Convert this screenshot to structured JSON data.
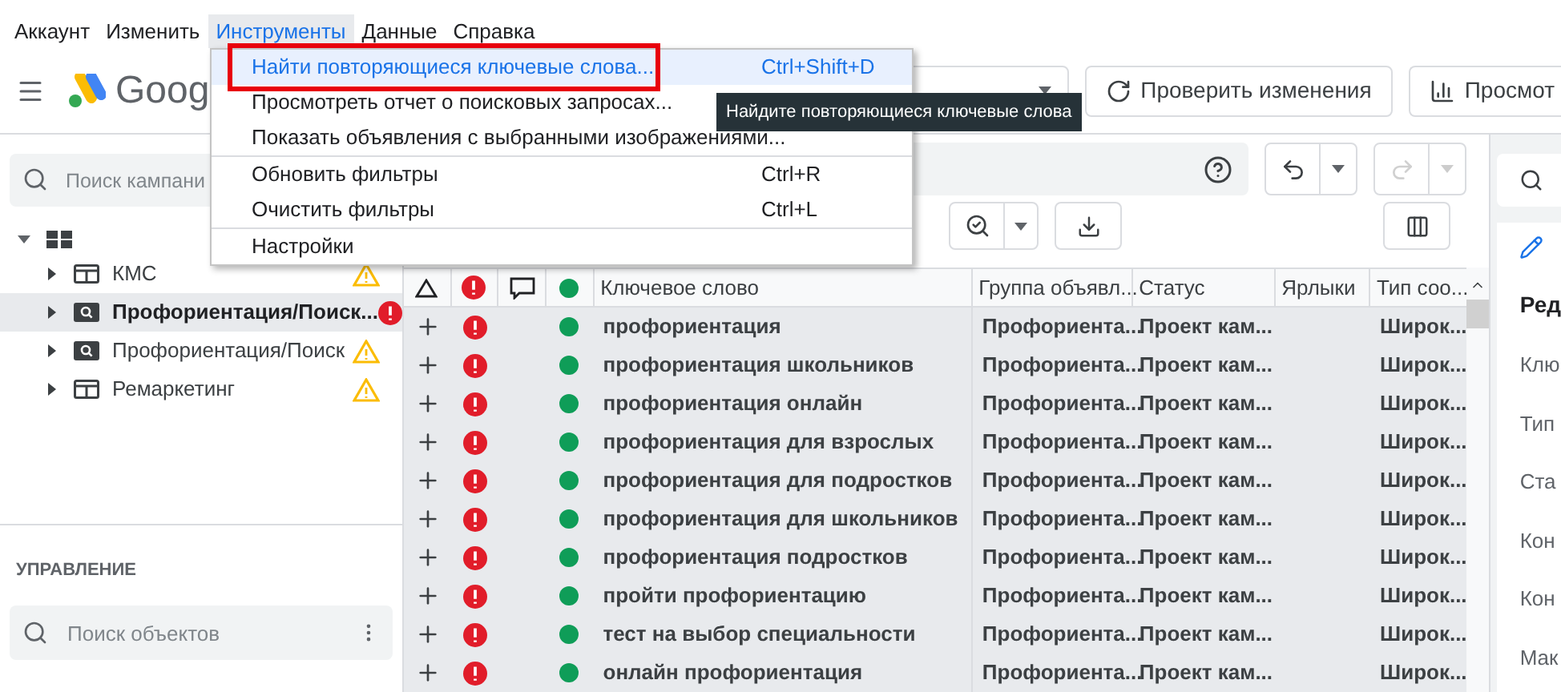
{
  "menu_bar": [
    {
      "label": "Аккаунт",
      "selected": false
    },
    {
      "label": "Изменить",
      "selected": false
    },
    {
      "label": "Инструменты",
      "selected": true
    },
    {
      "label": "Данные",
      "selected": false
    },
    {
      "label": "Справка",
      "selected": false
    }
  ],
  "header": {
    "logo_text": "Goog",
    "buttons": [
      {
        "label": "Проверить изменения",
        "kind": "check"
      },
      {
        "label": "Просмот",
        "kind": "stats"
      }
    ]
  },
  "dropdown": {
    "groups": [
      [
        {
          "label": "Найти повторяющиеся ключевые слова...",
          "shortcut": "Ctrl+Shift+D",
          "selected": true
        },
        {
          "label": "Просмотреть отчет о поисковых запросах...",
          "selected": false
        },
        {
          "label": "Показать объявления с выбранными изображениями...",
          "selected": false
        }
      ],
      [
        {
          "label": "Обновить фильтры",
          "shortcut": "Ctrl+R",
          "selected": false
        },
        {
          "label": "Очистить фильтры",
          "shortcut": "Ctrl+L",
          "selected": false
        }
      ],
      [
        {
          "label": "Настройки",
          "selected": false
        }
      ]
    ]
  },
  "tooltip": "Найдите повторяющиеся ключевые слова",
  "sidebar": {
    "search": {
      "placeholder": "Поиск кампани"
    },
    "tree": {
      "expanded": true,
      "children": [
        {
          "name": "КМС",
          "kind": "display",
          "error": false,
          "selected": false,
          "expanded": false
        },
        {
          "name": "Профориентация/Поиск...",
          "kind": "search",
          "error": true,
          "selected": true,
          "expanded": false
        },
        {
          "name": "Профориентация/Поиск",
          "kind": "search",
          "error": false,
          "selected": false,
          "expanded": false
        },
        {
          "name": "Ремаркетинг",
          "kind": "display",
          "error": false,
          "selected": false,
          "expanded": false
        }
      ]
    },
    "section_title": "УПРАВЛЕНИЕ",
    "object_search": {
      "placeholder": "Поиск объектов"
    }
  },
  "toolbar": {
    "undo_disabled": false,
    "redo_disabled": true
  },
  "table": {
    "columns": [
      "Ключевое слово",
      "Группа объявл...",
      "Статус",
      "Ярлыки",
      "Тип соо..."
    ],
    "rows": [
      {
        "keyword": "профориентация",
        "group": "Профориента...",
        "status": "Проект кам...",
        "type": "Широк...",
        "selected": true
      },
      {
        "keyword": "профориентация школьников",
        "group": "Профориента...",
        "status": "Проект кам...",
        "type": "Широк...",
        "selected": true
      },
      {
        "keyword": "профориентация онлайн",
        "group": "Профориента...",
        "status": "Проект кам...",
        "type": "Широк...",
        "selected": true
      },
      {
        "keyword": "профориентация для взрослых",
        "group": "Профориента...",
        "status": "Проект кам...",
        "type": "Широк...",
        "selected": true
      },
      {
        "keyword": "профориентация для подростков",
        "group": "Профориента...",
        "status": "Проект кам...",
        "type": "Широк...",
        "selected": true
      },
      {
        "keyword": "профориентация для школьников",
        "group": "Профориента...",
        "status": "Проект кам...",
        "type": "Широк...",
        "selected": true
      },
      {
        "keyword": "профориентация подростков",
        "group": "Профориента...",
        "status": "Проект кам...",
        "type": "Широк...",
        "selected": true
      },
      {
        "keyword": "пройти профориентацию",
        "group": "Профориента...",
        "status": "Проект кам...",
        "type": "Широк...",
        "selected": true
      },
      {
        "keyword": "тест на выбор специальности",
        "group": "Профориента...",
        "status": "Проект кам...",
        "type": "Широк...",
        "selected": true
      },
      {
        "keyword": "онлайн профориентация",
        "group": "Профориента...",
        "status": "Проект кам...",
        "type": "Широк...",
        "selected": true
      }
    ]
  },
  "right_panel": {
    "title": "Ред",
    "labels": [
      "Клю",
      "Тип",
      "Ста",
      "Кон",
      "Кон",
      "Мак"
    ]
  }
}
